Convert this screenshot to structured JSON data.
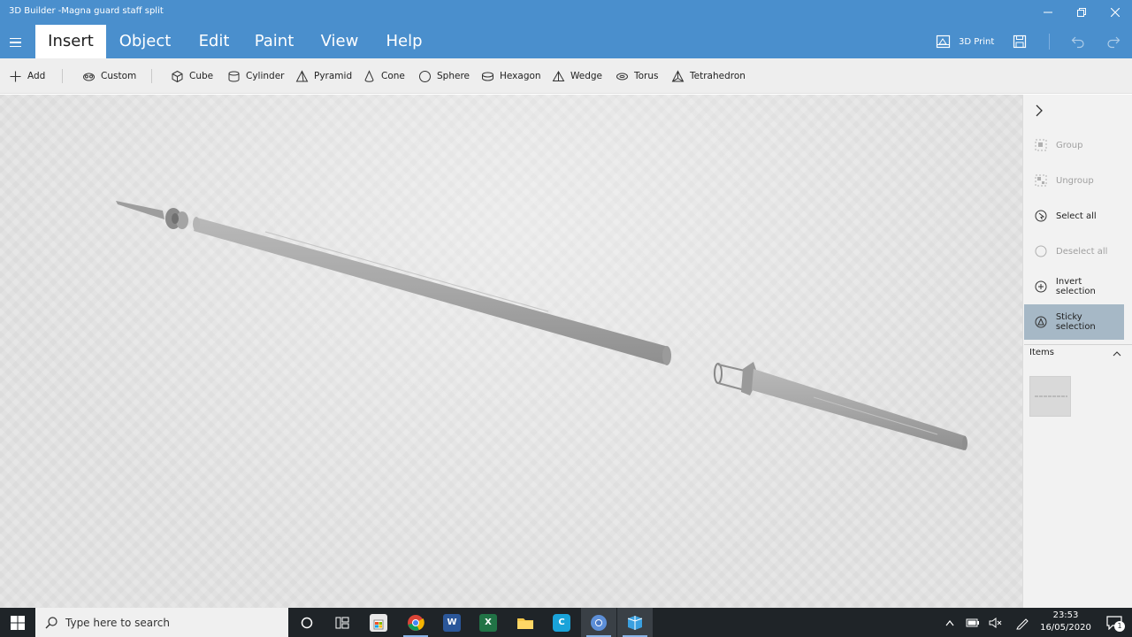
{
  "window": {
    "title": "3D Builder -Magna guard staff split"
  },
  "menu": {
    "tabs": [
      {
        "label": "Insert"
      },
      {
        "label": "Object"
      },
      {
        "label": "Edit"
      },
      {
        "label": "Paint"
      },
      {
        "label": "View"
      },
      {
        "label": "Help"
      }
    ],
    "print_label": "3D Print"
  },
  "toolbar": {
    "add_label": "Add",
    "custom_label": "Custom",
    "shapes": [
      "Cube",
      "Cylinder",
      "Pyramid",
      "Cone",
      "Sphere",
      "Hexagon",
      "Wedge",
      "Torus",
      "Tetrahedron"
    ]
  },
  "panel": {
    "actions": [
      {
        "label": "Group",
        "enabled": false
      },
      {
        "label": "Ungroup",
        "enabled": false
      },
      {
        "label": "Select all",
        "enabled": true
      },
      {
        "label": "Deselect all",
        "enabled": false
      },
      {
        "label": "Invert selection",
        "enabled": true
      },
      {
        "label": "Sticky selection",
        "enabled": true,
        "active": true
      }
    ],
    "items_label": "Items"
  },
  "taskbar": {
    "search_placeholder": "Type here to search",
    "time": "23:53",
    "date": "16/05/2020",
    "notification_count": "1"
  },
  "colors": {
    "accent": "#4a8fcd",
    "taskbar": "#1f2428",
    "model": "#a8a8a8"
  }
}
